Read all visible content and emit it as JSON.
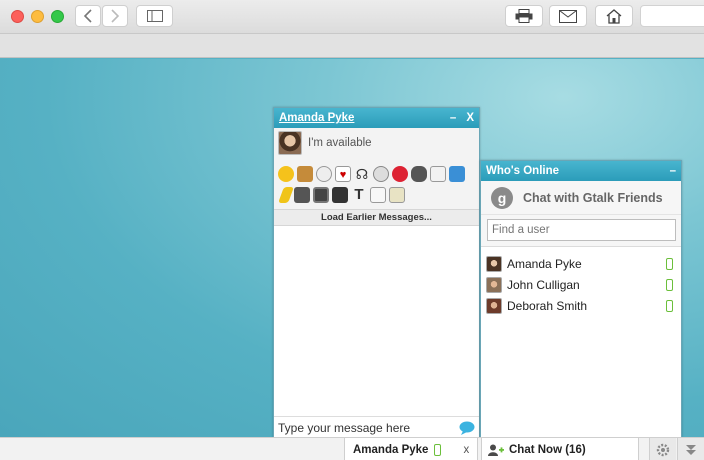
{
  "chat_window": {
    "title": "Amanda Pyke",
    "minimize": "–",
    "close": "X",
    "status": "I'm available",
    "load_earlier": "Load Earlier Messages...",
    "input_placeholder": "Type your message here"
  },
  "online_panel": {
    "title": "Who's Online",
    "minimize": "–",
    "gtalk_logo": "g",
    "gtalk_label": "Chat with Gtalk Friends",
    "find_placeholder": "Find a user",
    "users": [
      {
        "name": "Amanda Pyke",
        "device": "phone-icon"
      },
      {
        "name": "John Culligan",
        "device": "phone-icon"
      },
      {
        "name": "Deborah Smith",
        "device": "phone-icon"
      }
    ]
  },
  "chat_bar": {
    "amanda_tab": "Amanda Pyke",
    "amanda_close": "x",
    "chat_now": "Chat Now (16)"
  },
  "colors": {
    "header_blue": "#2b9cb9",
    "page_teal": "#56b1c4",
    "mobile_green": "#6bbf3b"
  }
}
